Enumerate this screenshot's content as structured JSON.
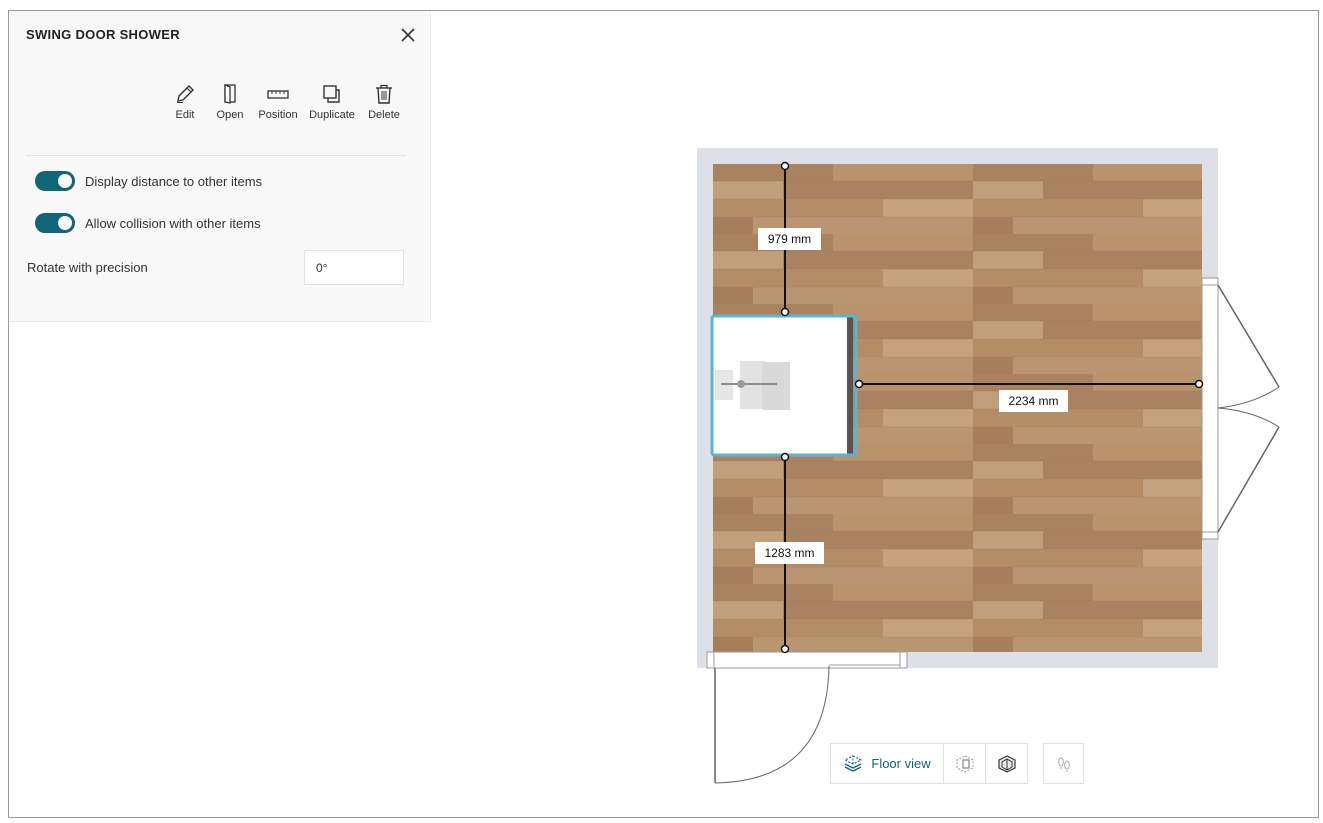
{
  "panel": {
    "title": "SWING DOOR SHOWER",
    "actions": [
      {
        "label": "Edit",
        "icon": "pencil-icon"
      },
      {
        "label": "Open",
        "icon": "door-open-icon"
      },
      {
        "label": "Position",
        "icon": "ruler-icon"
      },
      {
        "label": "Duplicate",
        "icon": "duplicate-icon"
      },
      {
        "label": "Delete",
        "icon": "trash-icon"
      }
    ],
    "toggles": [
      {
        "label": "Display distance to other items",
        "on": true
      },
      {
        "label": "Allow collision with other items",
        "on": true
      }
    ],
    "rotate": {
      "label": "Rotate with precision",
      "value": "0°"
    }
  },
  "plan": {
    "dimensions": {
      "top": "979 mm",
      "right": "2234 mm",
      "bottom": "1283 mm"
    },
    "colors": {
      "floor": "#b08a64",
      "wall": "#dde1e7",
      "selection": "#5ab4d8",
      "accent": "#0e6677"
    }
  },
  "view_toolbar": {
    "floor_view_label": "Floor view",
    "buttons": [
      "floor-view-icon",
      "wireframe-3d-icon",
      "solid-3d-icon",
      "walk-icon"
    ]
  }
}
